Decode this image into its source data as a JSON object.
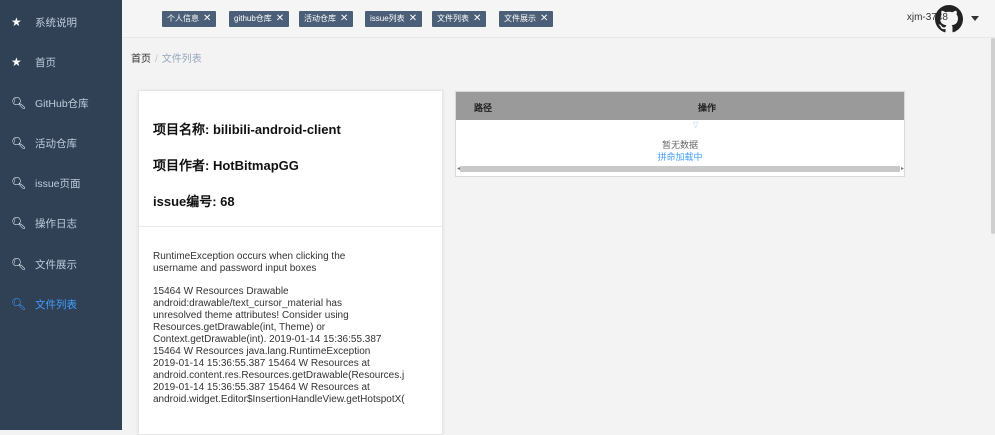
{
  "sidebar": {
    "items": [
      {
        "label": "系统说明",
        "icon": "star-icon"
      },
      {
        "label": "首页",
        "icon": "star-icon"
      },
      {
        "label": "GitHub仓库",
        "icon": "search-icon"
      },
      {
        "label": "活动仓库",
        "icon": "search-icon"
      },
      {
        "label": "issue页面",
        "icon": "search-icon"
      },
      {
        "label": "操作日志",
        "icon": "search-icon"
      },
      {
        "label": "文件展示",
        "icon": "search-icon"
      },
      {
        "label": "文件列表",
        "icon": "search-icon",
        "active": true
      }
    ]
  },
  "tags": [
    {
      "label": "个人信息"
    },
    {
      "label": "github仓库"
    },
    {
      "label": "活动仓库"
    },
    {
      "label": "issue列表"
    },
    {
      "label": "文件列表"
    },
    {
      "label": "文件展示"
    }
  ],
  "header": {
    "username": "xjm-3748"
  },
  "breadcrumb": {
    "home": "首页",
    "separator": "/",
    "current": "文件列表"
  },
  "card": {
    "project_name": "项目名称: bilibili-android-client",
    "project_author": "项目作者: HotBitmapGG",
    "issue_number": "issue编号: 68",
    "summary": "RuntimeException occurs when clicking the\nusername and password input boxes",
    "log": "15464 W Resources Drawable\nandroid:drawable/text_cursor_material has\nunresolved theme attributes! Consider using\nResources.getDrawable(int, Theme) or\nContext.getDrawable(int). 2019-01-14 15:36:55.387\n15464 W Resources java.lang.RuntimeException\n2019-01-14 15:36:55.387 15464 W Resources at\nandroid.content.res.Resources.getDrawable(Resources.j\n2019-01-14 15:36:55.387 15464 W Resources at\nandroid.widget.Editor$InsertionHandleView.getHotspotX("
  },
  "table": {
    "columns": [
      "路径",
      "操作"
    ],
    "empty_text": "暂无数据",
    "loading_text": "拼命加载中"
  },
  "colors": {
    "sidebar_bg": "#304156",
    "active": "#409eff",
    "tag_bg": "#4b5f78"
  }
}
